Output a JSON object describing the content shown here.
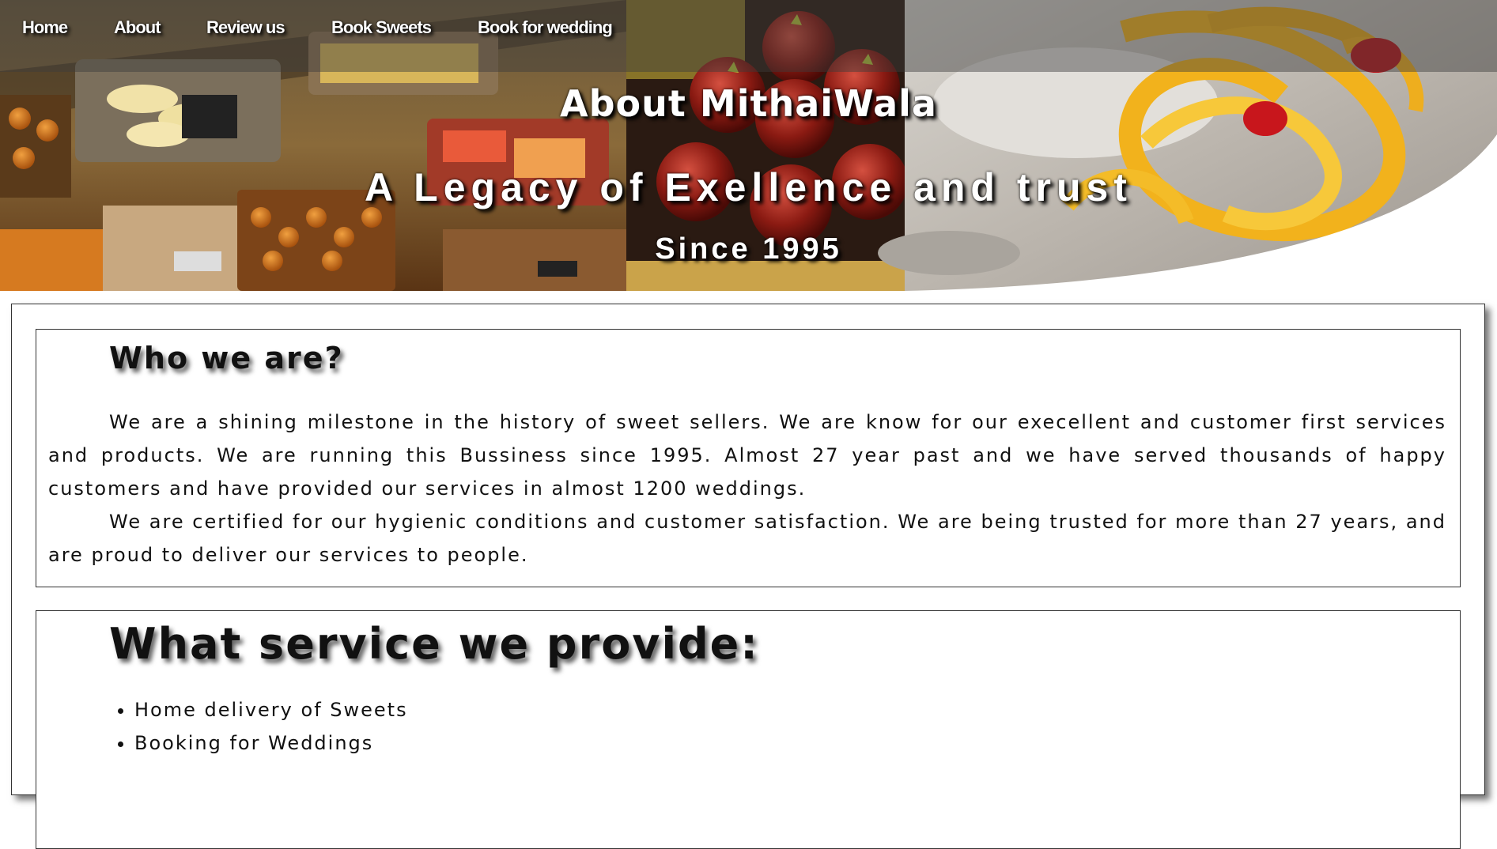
{
  "nav": {
    "items": [
      {
        "label": "Home"
      },
      {
        "label": "About"
      },
      {
        "label": "Review us"
      },
      {
        "label": "Book Sweets"
      },
      {
        "label": "Book for wedding"
      }
    ]
  },
  "hero": {
    "title": "About MithaiWala",
    "tagline": "A Legacy of Exellence and trust",
    "since": "Since 1995"
  },
  "who": {
    "heading": "Who we are?",
    "paragraphs": [
      "We are a shining milestone in the history of sweet sellers. We are know for our execellent and customer first services and products. We are running this Bussiness since 1995. Almost 27 year past and we have served thousands of happy customers and have provided our services in almost 1200 weddings.",
      "We are certified for our hygienic conditions and customer satisfaction. We are being trusted for more than 27 years, and are proud to deliver our services to people."
    ]
  },
  "services": {
    "heading": "What service we provide:",
    "items": [
      "Home delivery of Sweets",
      "Booking for Weddings"
    ]
  }
}
